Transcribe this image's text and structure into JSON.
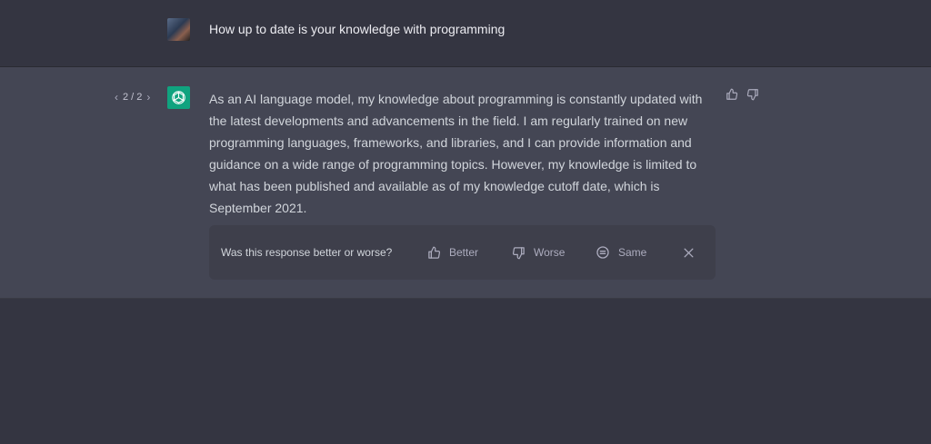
{
  "user": {
    "message": "How up to date is your knowledge with programming"
  },
  "assistant": {
    "pager": {
      "prev_icon": "chevron-left-icon",
      "label": "2 / 2",
      "next_icon": "chevron-right-icon"
    },
    "message": "As an AI language model, my knowledge about programming is constantly updated with the latest developments and advancements in the field. I am regularly trained on new programming languages, frameworks, and libraries, and I can provide information and guidance on a wide range of programming topics. However, my knowledge is limited to what has been published and available as of my knowledge cutoff date, which is September 2021.",
    "logo_color": "#10a37f"
  },
  "feedback": {
    "question": "Was this response better or worse?",
    "better_label": "Better",
    "worse_label": "Worse",
    "same_label": "Same"
  },
  "colors": {
    "page_bg": "#343541",
    "assistant_bg": "#444654",
    "feedback_bg": "#3e3f4b",
    "text": "#d1d5db"
  }
}
